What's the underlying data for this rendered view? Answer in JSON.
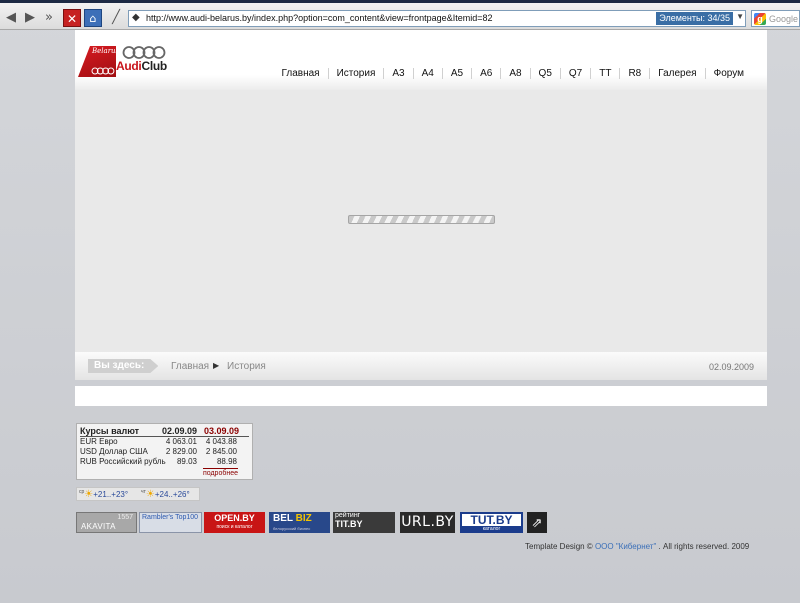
{
  "browser": {
    "url": "http://www.audi-belarus.by/index.php?option=com_content&view=frontpage&Itemid=82",
    "elements_badge": "Элементы:   34/35",
    "search_placeholder": "Google"
  },
  "site": {
    "logo_tag": "Belarus",
    "logo_text_audi": "Audi",
    "logo_text_club": "Club",
    "nav": [
      "Главная",
      "История",
      "A3",
      "A4",
      "A5",
      "A6",
      "A8",
      "Q5",
      "Q7",
      "TT",
      "R8",
      "Галерея",
      "Форум"
    ],
    "breadcrumb": {
      "label": "Вы здесь:",
      "home": "Главная",
      "current": "История",
      "date": "02.09.2009"
    }
  },
  "currency": {
    "title": "Курсы валют",
    "date1": "02.09.09",
    "date2": "03.09.09",
    "rows": [
      {
        "name": "EUR Евро",
        "v1": "4 063.01",
        "v2": "4 043.88"
      },
      {
        "name": "USD Доллар США",
        "v1": "2 829.00",
        "v2": "2 845.00"
      },
      {
        "name": "RUB Российский рубль",
        "v1": "89.03",
        "v2": "88.98"
      }
    ],
    "more": "подробнее"
  },
  "weather": {
    "day1": "ср",
    "temp1": "+21..+23°",
    "day2": "чт",
    "temp2": "+24..+26°"
  },
  "counters": {
    "akavita_num": "1557",
    "akavita_name": "AKAVITA",
    "rambler": "Rambler's Top100",
    "open": "OPEN.BY",
    "open_sub": "поиск и каталог",
    "belbiz_a": "BEL",
    "belbiz_b": "BIZ",
    "belbiz_sub": "белорусский бизнес",
    "titby_top": "рейтинг",
    "titby": "TIT.BY",
    "urlby": "URL.BY",
    "tutby": "TUT.BY",
    "tutby_sub": "каталог",
    "arrow": "⇗"
  },
  "copyright": {
    "prefix": "Template Design ©",
    "link": "ООО \"Кибернет\"",
    "suffix": ". All rights reserved. 2009"
  }
}
